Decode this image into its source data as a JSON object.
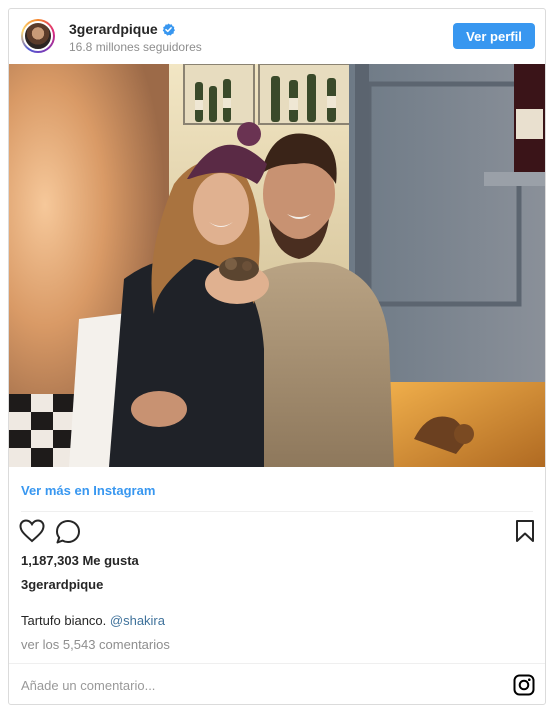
{
  "header": {
    "username": "3gerardpique",
    "followers": "16.8 millones seguidores",
    "follow_label": "Ver perfil",
    "verified_icon": "verified-badge-icon"
  },
  "post": {
    "more_link": "Ver más en Instagram",
    "likes": "1,187,303 Me gusta",
    "owner": "3gerardpique",
    "caption_text": "Tartufo bianco. ",
    "caption_mention": "@shakira",
    "view_comments": "ver los 5,543 comentarios"
  },
  "actions": {
    "like_icon": "heart-icon",
    "comment_icon": "comment-bubble-icon",
    "save_icon": "bookmark-icon",
    "brand_icon": "instagram-icon"
  },
  "comment_box": {
    "placeholder": "Añade un comentario..."
  },
  "colors": {
    "accent": "#3897f0",
    "border": "#dbdbdb",
    "muted": "#8e8e8e"
  }
}
